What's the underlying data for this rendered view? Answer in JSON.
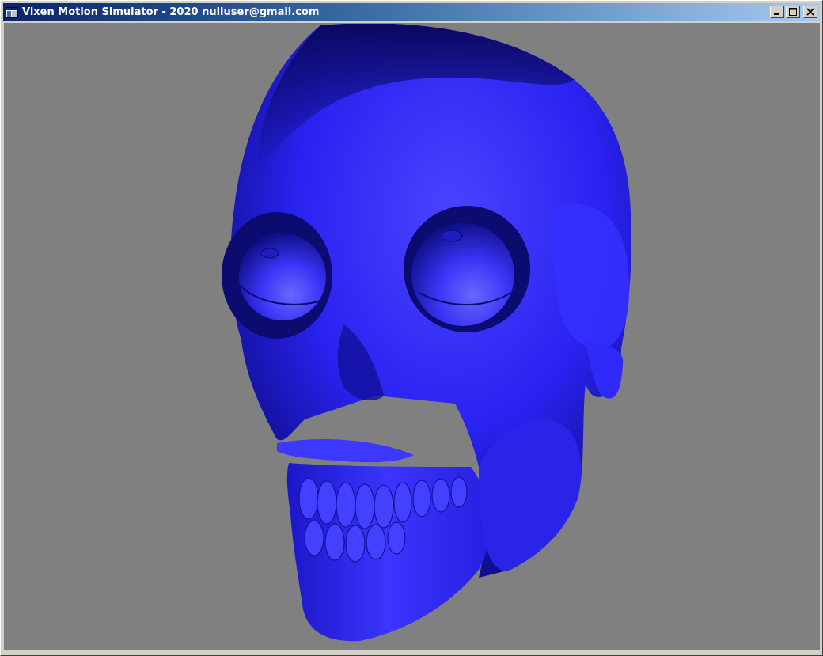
{
  "window": {
    "title": "Vixen Motion Simulator - 2020 nulluser@gmail.com",
    "icon": "app-window-icon",
    "controls": [
      "minimize-icon",
      "maximize-icon",
      "close-icon"
    ]
  },
  "viewport": {
    "background": "#808080",
    "object": "skull-3d-model",
    "object_color": "#2a22ff"
  }
}
